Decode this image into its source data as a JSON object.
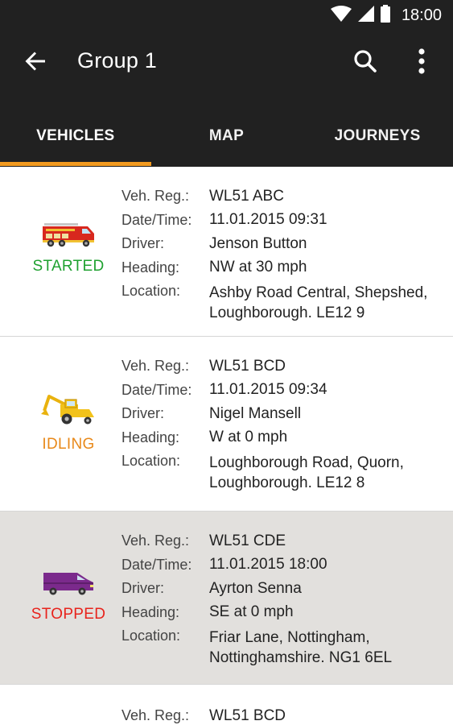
{
  "status_bar": {
    "time": "18:00"
  },
  "toolbar": {
    "title": "Group 1"
  },
  "tabs": [
    {
      "label": "VEHICLES"
    },
    {
      "label": "MAP"
    },
    {
      "label": "JOURNEYS"
    }
  ],
  "labels": {
    "veh_reg": "Veh. Reg.:",
    "date_time": "Date/Time:",
    "driver": "Driver:",
    "heading": "Heading:",
    "location": "Location:"
  },
  "vehicles": [
    {
      "icon": "fire-engine-icon",
      "status": "STARTED",
      "status_color": "#1fa130",
      "veh_reg": "WL51 ABC",
      "date_time": "11.01.2015  09:31",
      "driver": "Jenson Button",
      "heading": "NW at 30 mph",
      "location_line1": "Ashby Road Central, Shepshed,",
      "location_line2": "Loughborough. LE12 9"
    },
    {
      "icon": "digger-icon",
      "status": "IDLING",
      "status_color": "#e8891a",
      "veh_reg": "WL51 BCD",
      "date_time": "11.01.2015  09:34",
      "driver": "Nigel Mansell",
      "heading": "W at 0 mph",
      "location_line1": "Loughborough Road, Quorn,",
      "location_line2": "Loughborough. LE12 8"
    },
    {
      "icon": "van-icon",
      "status": "STOPPED",
      "status_color": "#e8231c",
      "veh_reg": "WL51 CDE",
      "date_time": "11.01.2015  18:00",
      "driver": "Ayrton Senna",
      "heading": "SE at 0 mph",
      "location_line1": "Friar Lane, Nottingham,",
      "location_line2": "Nottinghamshire. NG1 6EL"
    },
    {
      "veh_reg": "WL51 BCD"
    }
  ],
  "colors": {
    "appbar": "#212121",
    "tab_indicator": "#f29a1f",
    "selected_row": "#e2e0dd"
  }
}
